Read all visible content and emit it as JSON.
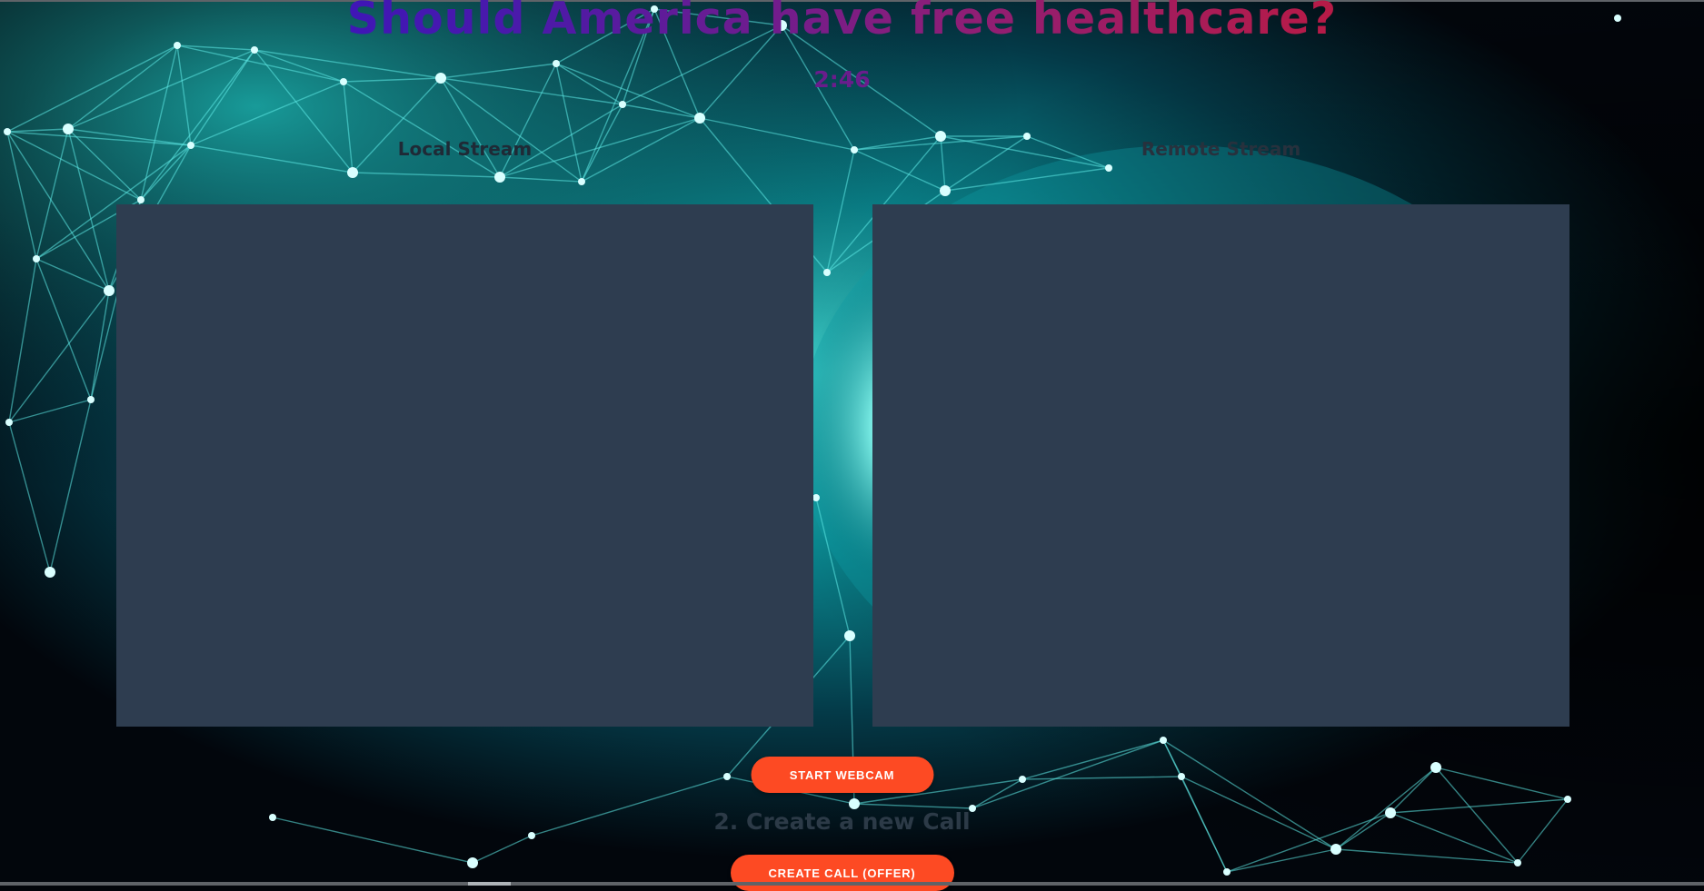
{
  "page": {
    "title": "Should America have free healthcare?",
    "timer": "2:46"
  },
  "streams": {
    "local_label": "Local Stream",
    "remote_label": "Remote Stream"
  },
  "controls": {
    "start_webcam_label": "START WEBCAM",
    "step_two_heading": "2. Create a new Call",
    "create_call_label": "CREATE CALL (OFFER)"
  },
  "colors": {
    "title_gradient_start": "#2a0fd0",
    "title_gradient_end": "#d0142c",
    "timer": "#6a1d8c",
    "video_placeholder": "#2e3d50",
    "button": "#fd4a23",
    "background_glow": "#00c6c6"
  },
  "background": {
    "description_icon": "neural-network-brain-background"
  }
}
